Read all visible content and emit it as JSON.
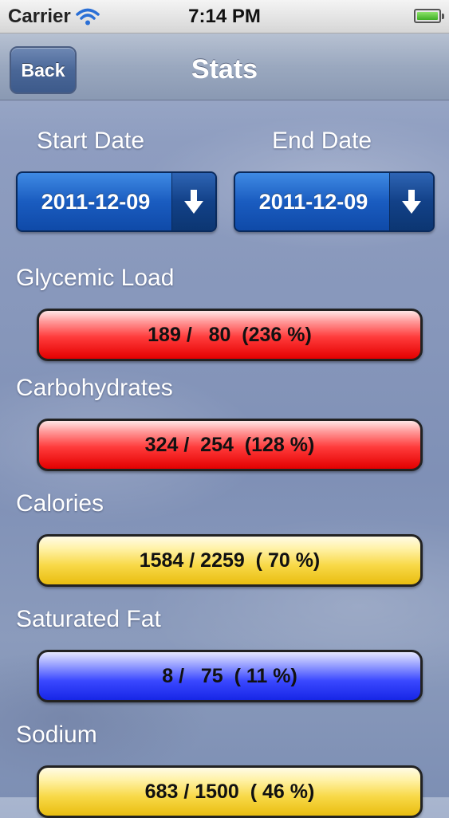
{
  "status_bar": {
    "carrier": "Carrier",
    "time": "7:14 PM"
  },
  "nav": {
    "back_label": "Back",
    "title": "Stats"
  },
  "dates": {
    "start_label": "Start Date",
    "start_value": "2011-12-09",
    "end_label": "End Date",
    "end_value": "2011-12-09"
  },
  "stats": [
    {
      "label": "Glycemic Load",
      "display": "189 /   80  (236 %)",
      "percent": 236,
      "color": "#ff2a2a"
    },
    {
      "label": "Carbohydrates",
      "display": "324 /  254  (128 %)",
      "percent": 128,
      "color": "#ff2a2a"
    },
    {
      "label": "Calories",
      "display": "1584 / 2259  ( 70 %)",
      "percent": 70,
      "color": "#f5d33a"
    },
    {
      "label": "Saturated Fat",
      "display": "8 /   75  ( 11 %)",
      "percent": 11,
      "color": "#2e3cff"
    },
    {
      "label": "Sodium",
      "display": "683 / 1500  ( 46 %)",
      "percent": 46,
      "color": "#f5d33a"
    }
  ]
}
